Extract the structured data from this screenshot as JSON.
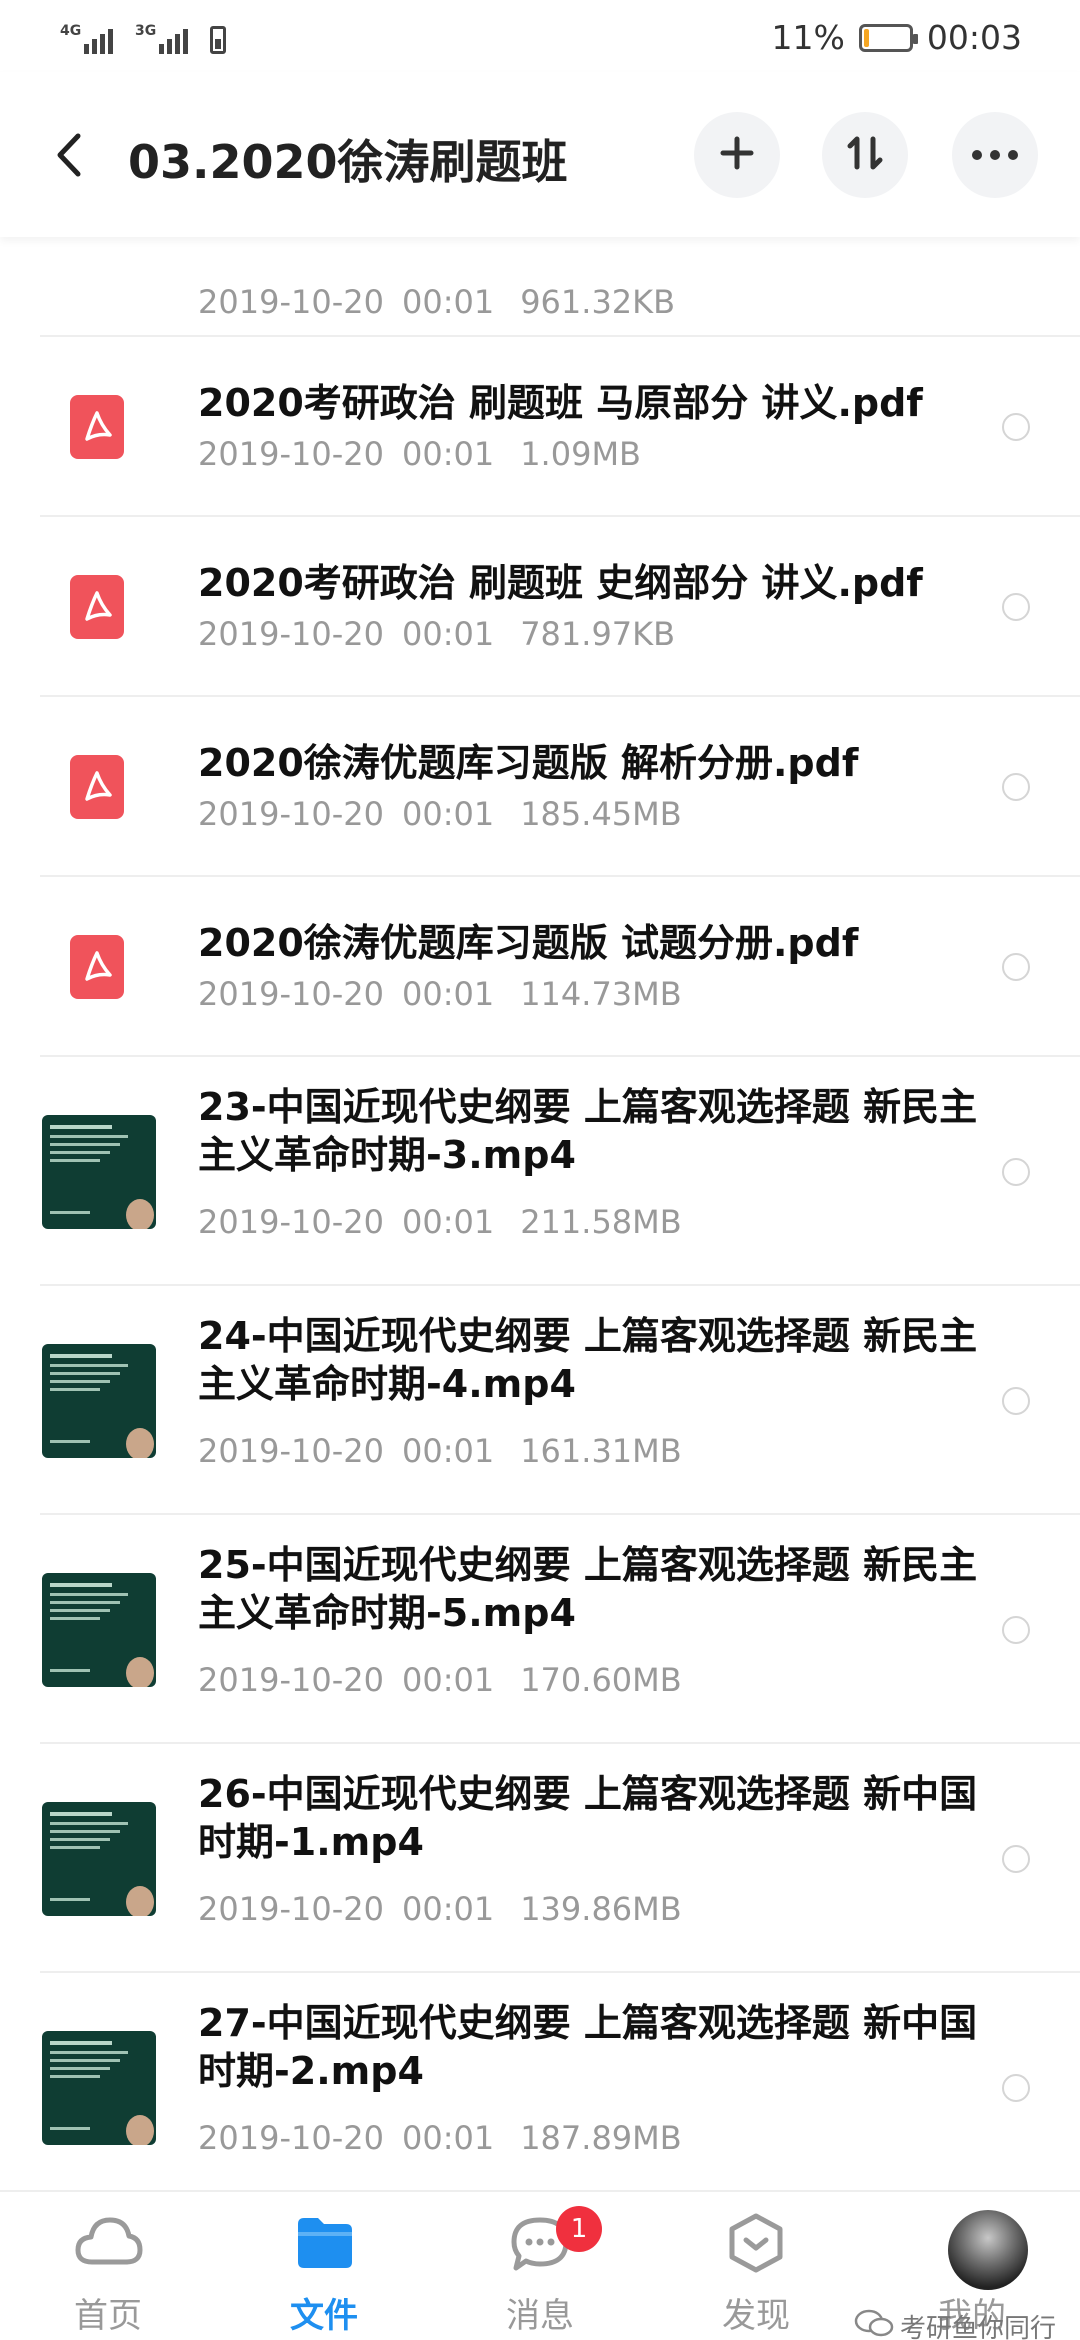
{
  "status_bar": {
    "network_1": "4G",
    "network_2": "3G",
    "battery_percent": "11%",
    "battery_level": 0.11,
    "time": "00:03"
  },
  "header": {
    "title": "03.2020徐涛刷题班",
    "icons": [
      "back-arrow-icon",
      "plus-icon",
      "sort-icon",
      "more-icon"
    ]
  },
  "files": [
    {
      "name": "",
      "date": "2019-10-20",
      "time": "00:01",
      "size": "961.32KB",
      "type": "partial"
    },
    {
      "name": "2020考研政治 刷题班 马原部分 讲义.pdf",
      "date": "2019-10-20",
      "time": "00:01",
      "size": "1.09MB",
      "type": "pdf"
    },
    {
      "name": "2020考研政治 刷题班 史纲部分 讲义.pdf",
      "date": "2019-10-20",
      "time": "00:01",
      "size": "781.97KB",
      "type": "pdf"
    },
    {
      "name": "2020徐涛优题库习题版 解析分册.pdf",
      "date": "2019-10-20",
      "time": "00:01",
      "size": "185.45MB",
      "type": "pdf"
    },
    {
      "name": "2020徐涛优题库习题版 试题分册.pdf",
      "date": "2019-10-20",
      "time": "00:01",
      "size": "114.73MB",
      "type": "pdf"
    },
    {
      "name": "23-中国近现代史纲要 上篇客观选择题 新民主主义革命时期-3.mp4",
      "date": "2019-10-20",
      "time": "00:01",
      "size": "211.58MB",
      "type": "video"
    },
    {
      "name": "24-中国近现代史纲要 上篇客观选择题 新民主主义革命时期-4.mp4",
      "date": "2019-10-20",
      "time": "00:01",
      "size": "161.31MB",
      "type": "video"
    },
    {
      "name": "25-中国近现代史纲要 上篇客观选择题 新民主主义革命时期-5.mp4",
      "date": "2019-10-20",
      "time": "00:01",
      "size": "170.60MB",
      "type": "video"
    },
    {
      "name": "26-中国近现代史纲要 上篇客观选择题 新中国时期-1.mp4",
      "date": "2019-10-20",
      "time": "00:01",
      "size": "139.86MB",
      "type": "video"
    },
    {
      "name": "27-中国近现代史纲要 上篇客观选择题 新中国时期-2.mp4",
      "date": "2019-10-20",
      "time": "00:01",
      "size": "187.89MB",
      "type": "video"
    }
  ],
  "bottom_nav": [
    {
      "label": "首页",
      "icon": "cloud-icon",
      "active": false
    },
    {
      "label": "文件",
      "icon": "folder-icon",
      "active": true
    },
    {
      "label": "消息",
      "icon": "chat-icon",
      "active": false,
      "badge": "1"
    },
    {
      "label": "发现",
      "icon": "discover-icon",
      "active": false
    },
    {
      "label": "我的",
      "icon": "avatar",
      "active": false
    }
  ],
  "watermark": "考研鱼你同行",
  "colors": {
    "accent": "#1e8ff0",
    "pdf_icon": "#f0535b",
    "badge": "#f0303e",
    "battery": "#f5a623"
  }
}
